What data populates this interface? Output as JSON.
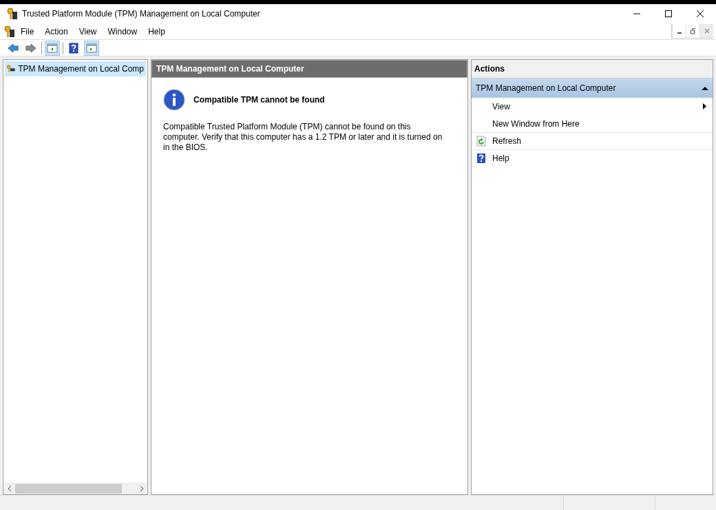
{
  "window": {
    "title": "Trusted Platform Module (TPM) Management on Local Computer"
  },
  "menu": [
    "File",
    "Action",
    "View",
    "Window",
    "Help"
  ],
  "toolbar": [
    {
      "kind": "back",
      "pressed": false
    },
    {
      "kind": "forward",
      "pressed": false
    },
    {
      "kind": "separator"
    },
    {
      "kind": "console-tree",
      "pressed": true
    },
    {
      "kind": "separator"
    },
    {
      "kind": "help",
      "pressed": false
    },
    {
      "kind": "action-pane",
      "pressed": true
    }
  ],
  "tree": {
    "items": [
      {
        "label": "TPM Management on Local Comp",
        "selected": true
      }
    ]
  },
  "center": {
    "header": "TPM Management on Local Computer",
    "message_title": "Compatible TPM cannot be found",
    "message_body": "Compatible Trusted Platform Module (TPM) cannot be found on this computer. Verify that this computer has a 1.2 TPM or later and it is turned on in the BIOS."
  },
  "actions": {
    "header": "Actions",
    "groups": [
      {
        "title": "TPM Management on Local Computer",
        "expanded": true,
        "items": [
          {
            "label": "View",
            "kind": "submenu",
            "separator_before": false
          },
          {
            "label": "New Window from Here",
            "kind": "plain",
            "separator_before": false
          },
          {
            "label": "Refresh",
            "kind": "refresh",
            "separator_before": true
          },
          {
            "label": "Help",
            "kind": "help",
            "separator_before": true
          }
        ]
      }
    ]
  }
}
